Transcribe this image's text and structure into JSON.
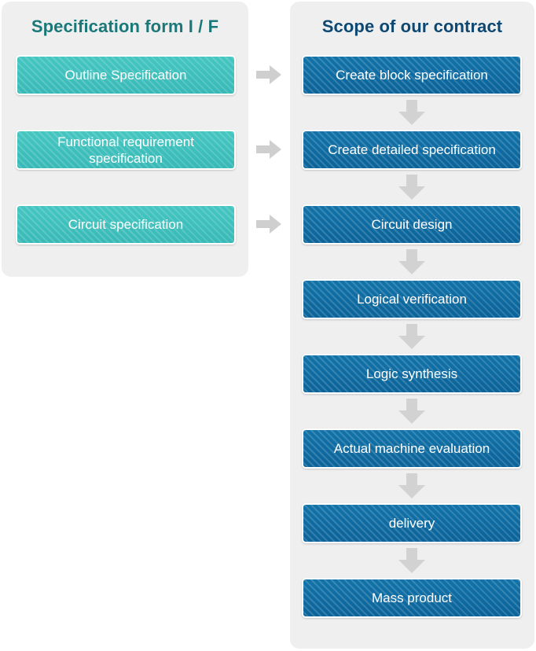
{
  "panels": {
    "left": {
      "title": "Specification form I / F",
      "nodes": [
        {
          "label": "Outline Specification"
        },
        {
          "label": "Functional requirement specification"
        },
        {
          "label": "Circuit specification"
        }
      ]
    },
    "right": {
      "title": "Scope of our contract",
      "nodes": [
        {
          "label": "Create block specification"
        },
        {
          "label": "Create detailed specification"
        },
        {
          "label": "Circuit design"
        },
        {
          "label": "Logical verification"
        },
        {
          "label": "Logic synthesis"
        },
        {
          "label": "Actual machine evaluation"
        },
        {
          "label": "delivery"
        },
        {
          "label": "Mass product"
        }
      ]
    }
  },
  "connectors": {
    "horizontal_icon": "arrow-right-icon",
    "vertical_icon": "arrow-down-icon",
    "horizontal_count": 3,
    "vertical_count": 7
  },
  "colors": {
    "panel_background": "#efefef",
    "left_title": "#1b7878",
    "right_title": "#0d4872",
    "left_node": "#3fc0bd",
    "right_node": "#0e6da4",
    "arrow": "#cfcfcf",
    "node_text": "#ffffff"
  }
}
